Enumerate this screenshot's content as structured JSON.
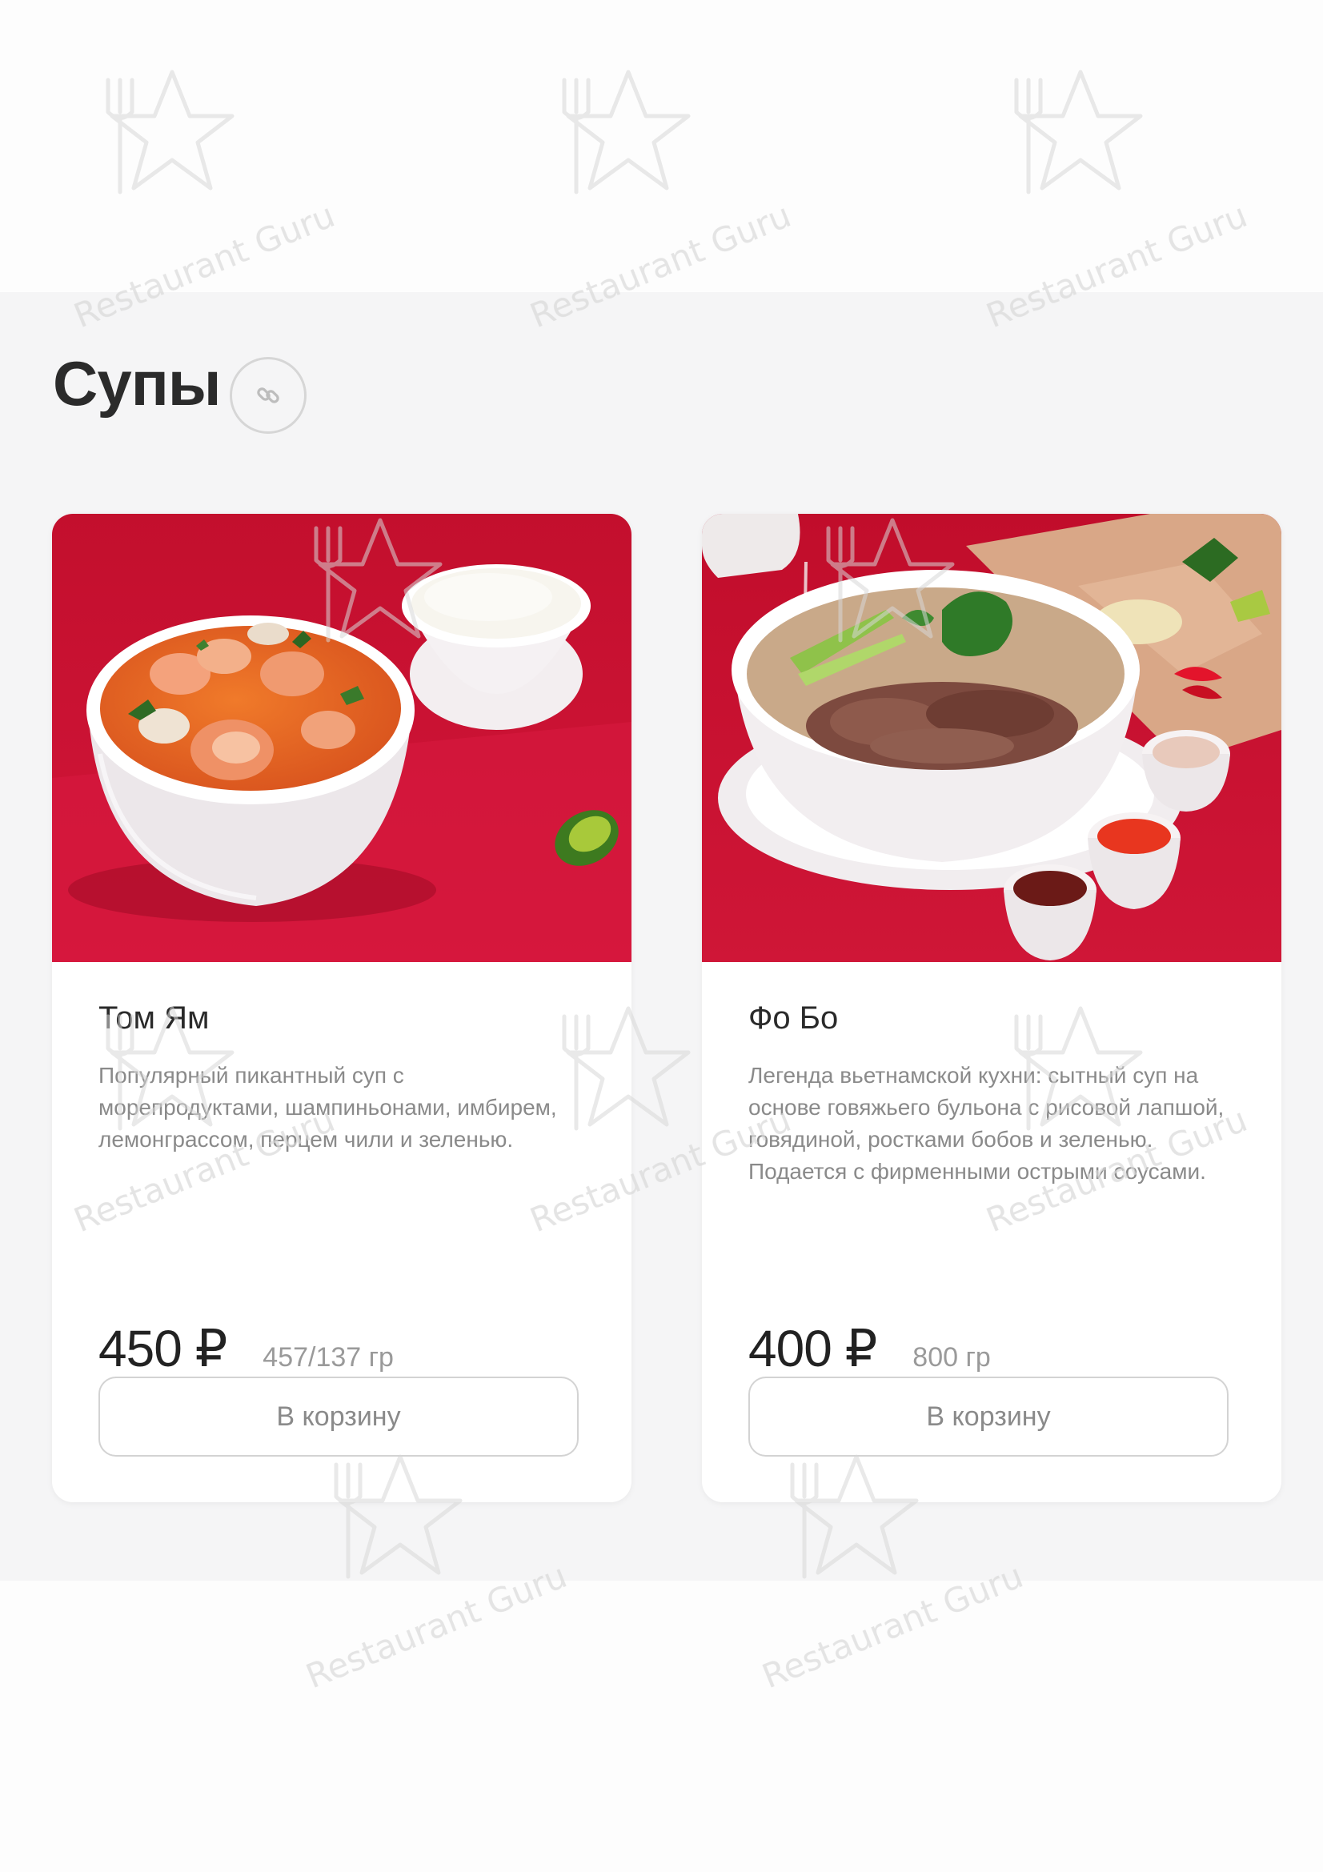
{
  "section": {
    "title": "Супы",
    "link_icon": "link-icon"
  },
  "watermark": {
    "text": "Restaurant Guru",
    "icon": "fork-star-logo"
  },
  "colors": {
    "photo_background": "#c8102e",
    "card_background": "#ffffff",
    "section_background": "#f5f5f6"
  },
  "products": [
    {
      "name": "Том Ям",
      "description": "Популярный пикантный суп с морепродуктами, шампиньонами, имбирем, лемонграссом, перцем чили и зеленью.",
      "price": "450 ₽",
      "weight": "457/137 гр",
      "button": "В корзину"
    },
    {
      "name": "Фо Бо",
      "description": "Легенда вьетнамской кухни: сытный суп на основе говяжьего бульона с рисовой лапшой, говядиной, ростками бобов и зеленью. Подается с фирменными острыми соусами.",
      "price": "400 ₽",
      "weight": "800 гр",
      "button": "В корзину"
    }
  ]
}
